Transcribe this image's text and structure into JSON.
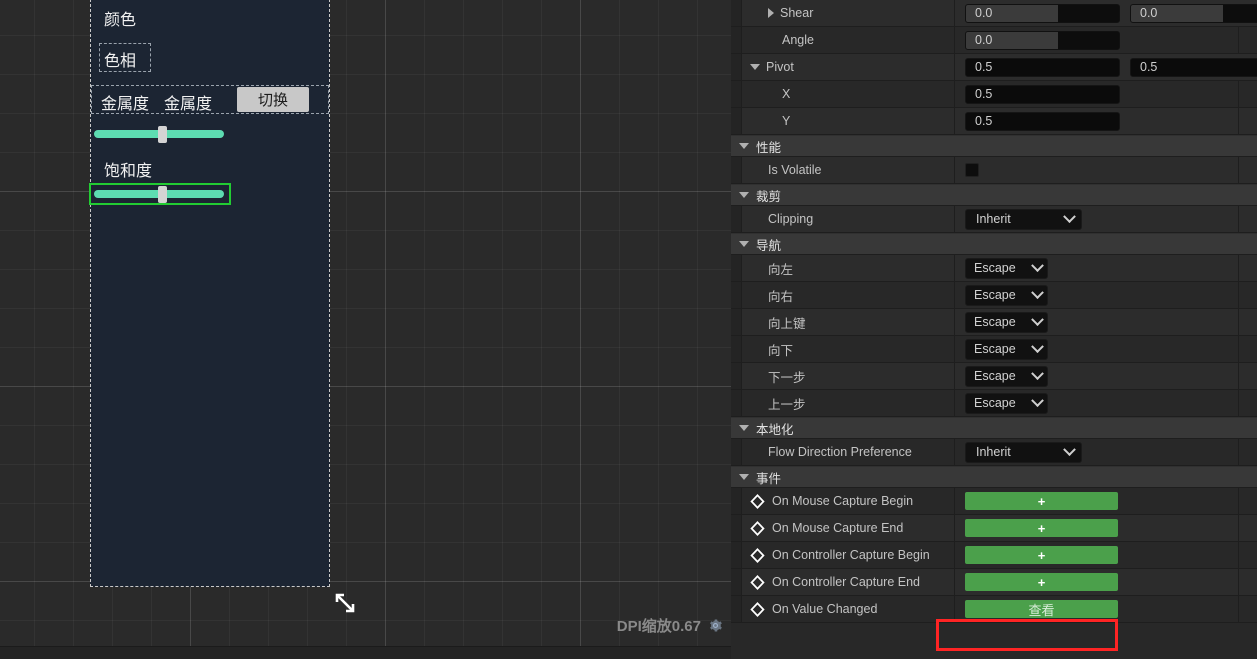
{
  "designer": {
    "widget_labels": {
      "color": "颜色",
      "hue": "色相",
      "metallic_a": "金属度",
      "metallic_b": "金属度",
      "toggle_button": "切换",
      "saturation": "饱和度"
    },
    "sliders": [
      {
        "name": "hue-slider",
        "value_pct": 52
      },
      {
        "name": "saturation-slider",
        "value_pct": 52
      }
    ],
    "footer": {
      "dpi_label": "DPI缩放0.67",
      "gear_icon": "gear-icon"
    },
    "resize_handle_icon": "resize-diagonal-icon"
  },
  "details": {
    "rows": [
      {
        "type": "prop",
        "expander": "right",
        "indent": 1,
        "label": "Shear",
        "fields": [
          {
            "kind": "spin",
            "value": "0.0"
          },
          {
            "kind": "spin",
            "value": "0.0"
          }
        ]
      },
      {
        "type": "prop",
        "indent": 2,
        "label": "Angle",
        "fields": [
          {
            "kind": "spin",
            "value": "0.0"
          }
        ]
      },
      {
        "type": "prop",
        "expander": "down",
        "indent": 0,
        "label": "Pivot",
        "fields": [
          {
            "kind": "num",
            "value": "0.5"
          },
          {
            "kind": "num",
            "value": "0.5"
          }
        ]
      },
      {
        "type": "prop",
        "indent": 2,
        "label": "X",
        "fields": [
          {
            "kind": "num",
            "value": "0.5"
          }
        ]
      },
      {
        "type": "prop",
        "indent": 2,
        "label": "Y",
        "fields": [
          {
            "kind": "num",
            "value": "0.5"
          }
        ]
      },
      {
        "type": "section",
        "label": "性能"
      },
      {
        "type": "prop",
        "indent": 1,
        "label": "Is Volatile",
        "fields": [
          {
            "kind": "checkbox",
            "checked": false
          }
        ]
      },
      {
        "type": "section",
        "label": "裁剪"
      },
      {
        "type": "prop",
        "indent": 1,
        "label": "Clipping",
        "fields": [
          {
            "kind": "combo-wide",
            "value": "Inherit"
          }
        ]
      },
      {
        "type": "section",
        "label": "导航"
      },
      {
        "type": "prop",
        "indent": 1,
        "label": "向左",
        "fields": [
          {
            "kind": "combo-narrow",
            "value": "Escape"
          }
        ]
      },
      {
        "type": "prop",
        "indent": 1,
        "label": "向右",
        "fields": [
          {
            "kind": "combo-narrow",
            "value": "Escape"
          }
        ]
      },
      {
        "type": "prop",
        "indent": 1,
        "label": "向上键",
        "fields": [
          {
            "kind": "combo-narrow",
            "value": "Escape"
          }
        ]
      },
      {
        "type": "prop",
        "indent": 1,
        "label": "向下",
        "fields": [
          {
            "kind": "combo-narrow",
            "value": "Escape"
          }
        ]
      },
      {
        "type": "prop",
        "indent": 1,
        "label": "下一步",
        "fields": [
          {
            "kind": "combo-narrow",
            "value": "Escape"
          }
        ]
      },
      {
        "type": "prop",
        "indent": 1,
        "label": "上一步",
        "fields": [
          {
            "kind": "combo-narrow",
            "value": "Escape"
          }
        ]
      },
      {
        "type": "section",
        "label": "本地化"
      },
      {
        "type": "prop",
        "indent": 1,
        "label": "Flow Direction Preference",
        "fields": [
          {
            "kind": "combo-wide",
            "value": "Inherit"
          }
        ]
      },
      {
        "type": "section",
        "label": "事件"
      },
      {
        "type": "event",
        "label": "On Mouse Capture Begin",
        "button": "+"
      },
      {
        "type": "event",
        "label": "On Mouse Capture End",
        "button": "+"
      },
      {
        "type": "event",
        "label": "On Controller Capture Begin",
        "button": "+"
      },
      {
        "type": "event",
        "label": "On Controller Capture End",
        "button": "+"
      },
      {
        "type": "event",
        "label": "On Value Changed",
        "button": "查看",
        "highlighted": true
      }
    ]
  },
  "colors": {
    "accent_green": "#4ba04b",
    "highlight_red": "#ff2424",
    "slider_teal": "#5ddcb2",
    "widget_bg": "#1c2533",
    "panel_bg": "#282828"
  }
}
